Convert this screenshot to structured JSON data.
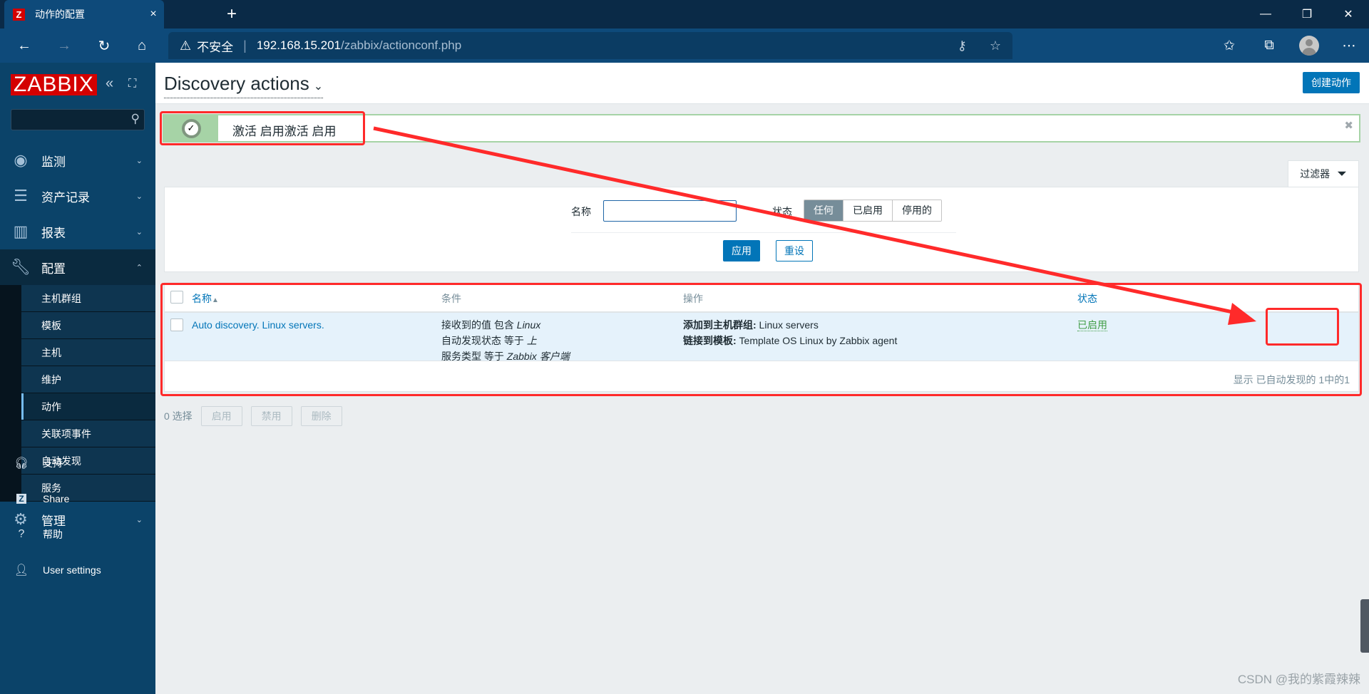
{
  "browser": {
    "tab_title": "动作的配置",
    "tab_favicon": "Z",
    "new_tab_icon": "+",
    "close_tab_icon": "×",
    "address_warning": "不安全",
    "address_host": "192.168.15.201",
    "address_path": "/zabbix/actionconf.php",
    "window_controls": {
      "minimize": "—",
      "restore": "❐",
      "close": "✕"
    }
  },
  "sidebar": {
    "logo": "ZABBIX",
    "search_placeholder": "",
    "menu": [
      {
        "label": "监测",
        "icon": "eye-icon"
      },
      {
        "label": "资产记录",
        "icon": "list-icon"
      },
      {
        "label": "报表",
        "icon": "bar-chart-icon"
      },
      {
        "label": "配置",
        "icon": "wrench-icon"
      }
    ],
    "submenu": [
      {
        "label": "主机群组"
      },
      {
        "label": "模板"
      },
      {
        "label": "主机"
      },
      {
        "label": "维护"
      },
      {
        "label": "动作"
      },
      {
        "label": "关联项事件"
      },
      {
        "label": "自动发现"
      },
      {
        "label": "服务"
      }
    ],
    "admin": {
      "label": "管理",
      "icon": "gear-icon"
    },
    "links": [
      {
        "label": "支持",
        "icon": "headset-icon"
      },
      {
        "label": "Share",
        "icon": "share-z-icon"
      },
      {
        "label": "帮助",
        "icon": "question-icon"
      },
      {
        "label": "User settings",
        "icon": "user-icon"
      }
    ]
  },
  "header": {
    "title": "Discovery actions",
    "create_button": "创建动作"
  },
  "message": {
    "text": "激活 启用激活 启用",
    "type": "success"
  },
  "filter": {
    "tab_label": "过滤器",
    "name_label": "名称",
    "name_value": "",
    "status_label": "状态",
    "status_options": [
      "任何",
      "已启用",
      "停用的"
    ],
    "status_selected": "任何",
    "apply_button": "应用",
    "reset_button": "重设"
  },
  "table": {
    "columns": {
      "name": "名称",
      "sort_indicator": "▲",
      "conditions": "条件",
      "operations": "操作",
      "status": "状态"
    },
    "rows": [
      {
        "name": "Auto discovery. Linux servers.",
        "conditions": [
          {
            "text": "接收到的值 包含 ",
            "value": "Linux"
          },
          {
            "text": "自动发现状态 等于 ",
            "value": "上"
          },
          {
            "text": "服务类型 等于 ",
            "value": "Zabbix 客户端"
          }
        ],
        "operations": [
          {
            "label": "添加到主机群组:",
            "value": " Linux servers"
          },
          {
            "label": "链接到模板:",
            "value": " Template OS Linux by Zabbix agent"
          }
        ],
        "status": "已启用"
      }
    ],
    "footer": "显示 已自动发现的 1中的1"
  },
  "bulk_actions": {
    "selected_count": "0 选择",
    "enable": "启用",
    "disable": "禁用",
    "delete": "删除"
  },
  "watermark": "CSDN @我的紫霞辣辣",
  "colors": {
    "accent": "#0275b8",
    "success": "#429e47",
    "sidebar": "#0b4369",
    "annotation": "#ff2a2a"
  }
}
